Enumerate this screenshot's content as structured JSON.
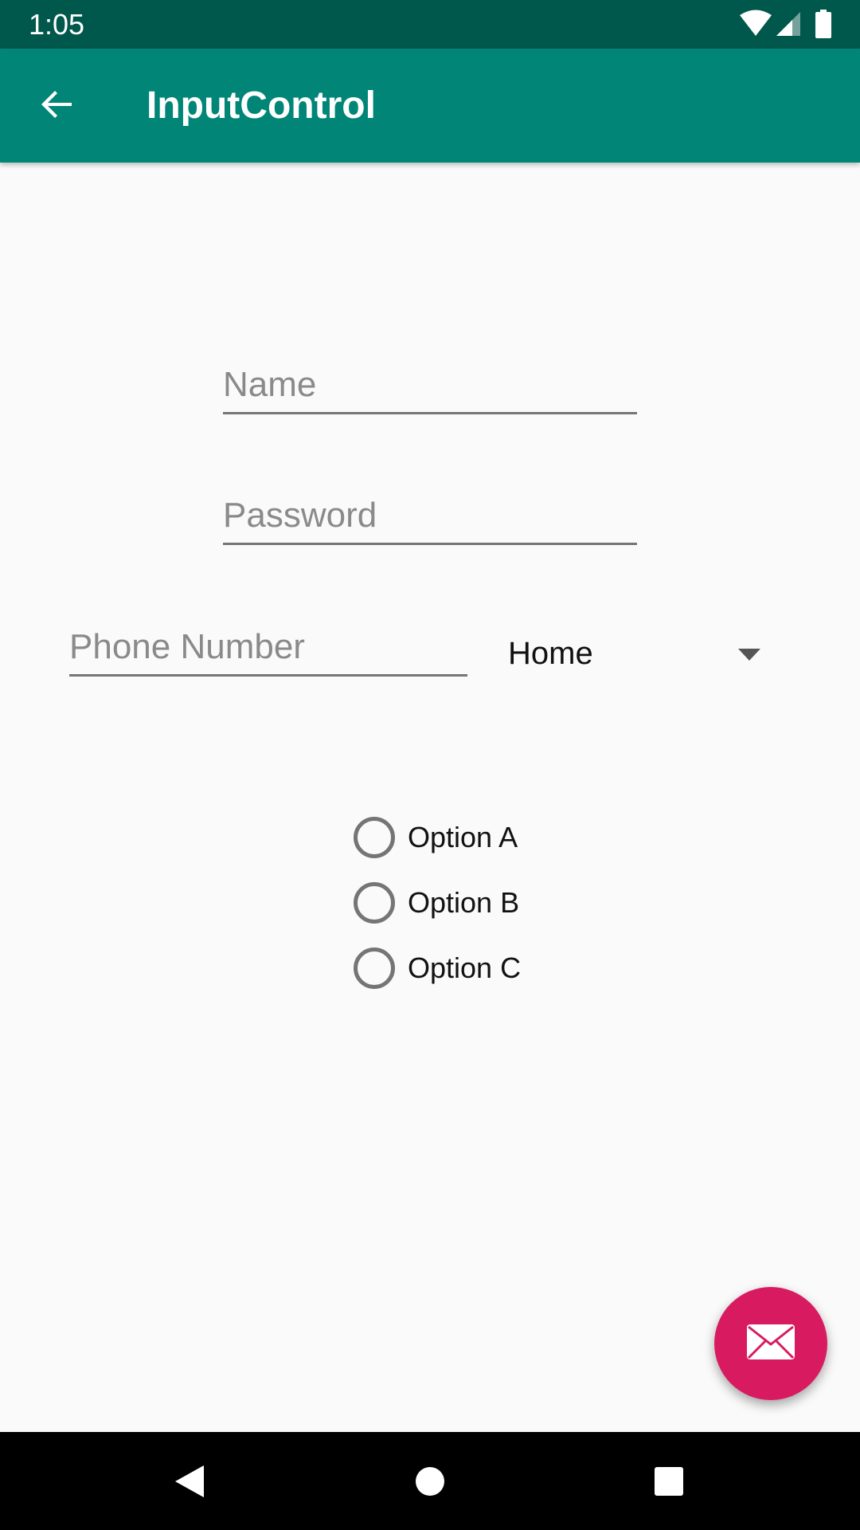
{
  "status_bar": {
    "time": "1:05",
    "icons": [
      "wifi-icon",
      "signal-icon",
      "battery-icon"
    ]
  },
  "app_bar": {
    "title": "InputControl",
    "back_icon": "arrow-back-icon",
    "color": "#008577"
  },
  "form": {
    "name": {
      "value": "",
      "placeholder": "Name"
    },
    "password": {
      "value": "",
      "placeholder": "Password"
    },
    "phone": {
      "value": "",
      "placeholder": "Phone Number"
    },
    "phone_type": {
      "selected": "Home",
      "icon": "dropdown-arrow-icon"
    },
    "radio_options": [
      {
        "label": "Option A",
        "checked": false
      },
      {
        "label": "Option B",
        "checked": false
      },
      {
        "label": "Option C",
        "checked": false
      }
    ]
  },
  "fab": {
    "icon": "email-icon",
    "color": "#d81b60"
  },
  "nav_bar": {
    "icons": [
      "nav-back-icon",
      "nav-home-icon",
      "nav-recents-icon"
    ]
  }
}
